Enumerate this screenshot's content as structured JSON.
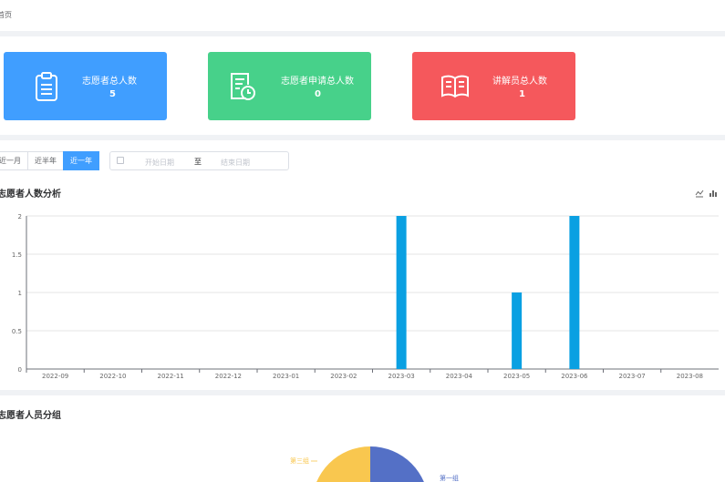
{
  "breadcrumb": {
    "home": "首页"
  },
  "stats": [
    {
      "label": "志愿者总人数",
      "value": "5",
      "icon": "clipboard-icon",
      "color": "#409eff"
    },
    {
      "label": "志愿者申请总人数",
      "value": "0",
      "icon": "document-clock-icon",
      "color": "#47d18a"
    },
    {
      "label": "讲解员总人数",
      "value": "1",
      "icon": "open-book-icon",
      "color": "#f5585c"
    }
  ],
  "filter": {
    "ranges": [
      "近一月",
      "近半年",
      "近一年"
    ],
    "active_range": "近一年",
    "start_placeholder": "开始日期",
    "separator": "至",
    "end_placeholder": "结束日期"
  },
  "bar_chart_title": "志愿者人数分析",
  "toolbox": [
    "line-chart-icon",
    "bar-chart-icon"
  ],
  "chart_data": {
    "type": "bar",
    "title": "志愿者人数分析",
    "categories": [
      "2022-09",
      "2022-10",
      "2022-11",
      "2022-12",
      "2023-01",
      "2023-02",
      "2023-03",
      "2023-04",
      "2023-05",
      "2023-06",
      "2023-07",
      "2023-08"
    ],
    "values": [
      0,
      0,
      0,
      0,
      0,
      0,
      2,
      0,
      1,
      2,
      0,
      0
    ],
    "ylim": [
      0,
      2
    ],
    "yticks": [
      "0",
      "0.5",
      "1",
      "1.5",
      "2"
    ],
    "grid": true,
    "color": "#0aa0e2"
  },
  "pie_chart_title": "志愿者人员分组",
  "pie": {
    "labels": [
      "第三组",
      "第一组"
    ],
    "colors": [
      "#f9c74f",
      "#5470c6"
    ]
  }
}
